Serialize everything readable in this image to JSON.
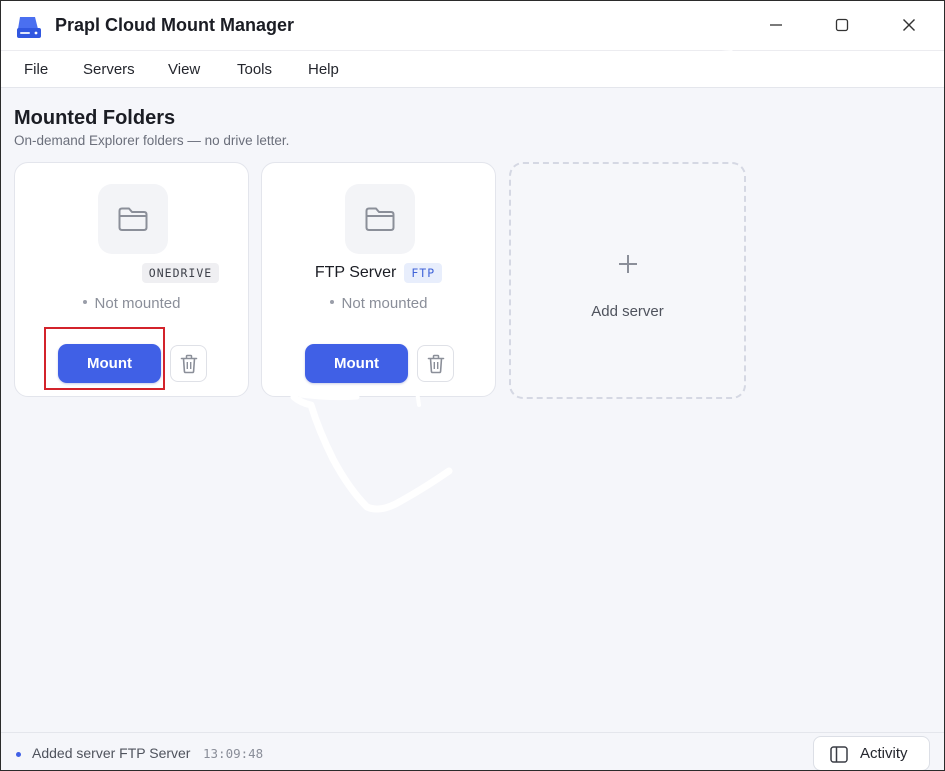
{
  "window": {
    "title": "Prapl Cloud Mount Manager"
  },
  "menu": {
    "items": [
      "File",
      "Servers",
      "View",
      "Tools",
      "Help"
    ]
  },
  "main": {
    "title": "Mounted Folders",
    "subtitle": "On-demand Explorer folders — no drive letter."
  },
  "cards": [
    {
      "name": "",
      "badge": "ONEDRIVE",
      "status": "Not mounted",
      "mount_label": "Mount",
      "icons": [
        "folder-icon",
        "trash-icon"
      ]
    },
    {
      "name": "FTP Server",
      "badge": "FTP",
      "status": "Not mounted",
      "mount_label": "Mount",
      "icons": [
        "folder-icon",
        "trash-icon"
      ]
    }
  ],
  "add_card": {
    "label": "Add server",
    "icon": "plus-icon"
  },
  "statusbar": {
    "log_message": "Added server FTP Server",
    "log_time": "13:09:48",
    "activity_label": "Activity",
    "activity_icon": "panel-icon"
  },
  "colors": {
    "accent": "#4060e6",
    "highlight": "#d3232b",
    "badge_blue_bg": "#e8eefc",
    "badge_gray_bg": "#efeff2"
  }
}
